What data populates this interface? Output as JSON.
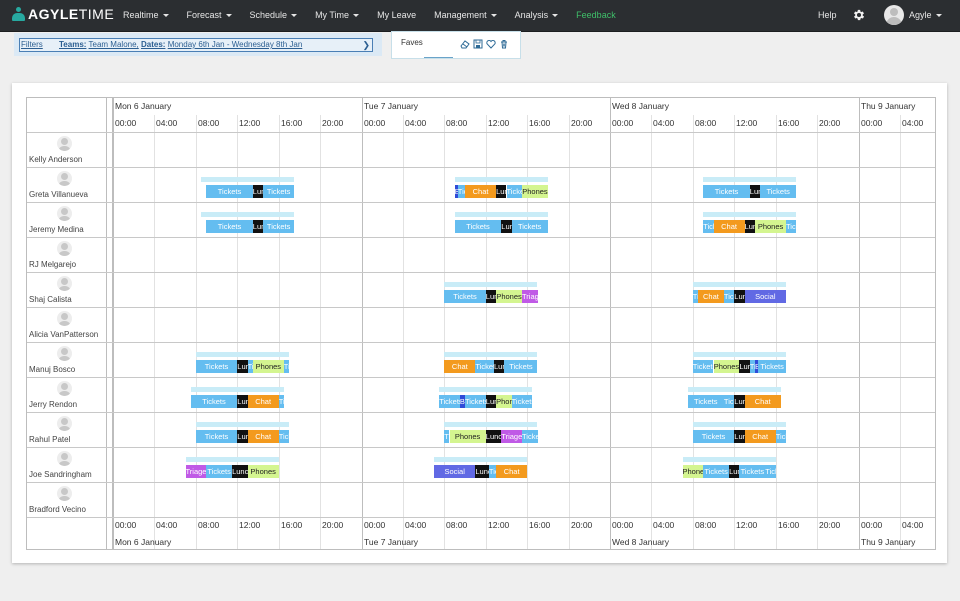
{
  "app": {
    "brand_bold": "AGYLE",
    "brand_light": "TIME"
  },
  "nav": {
    "items": [
      {
        "label": "Realtime",
        "caret": true,
        "color": "#e6e6e6"
      },
      {
        "label": "Forecast",
        "caret": true,
        "color": "#e6e6e6"
      },
      {
        "label": "Schedule",
        "caret": true,
        "color": "#e6e6e6"
      },
      {
        "label": "My Time",
        "caret": true,
        "color": "#e6e6e6"
      },
      {
        "label": "My Leave",
        "caret": false,
        "color": "#e6e6e6"
      },
      {
        "label": "Management",
        "caret": true,
        "color": "#e6e6e6"
      },
      {
        "label": "Analysis",
        "caret": true,
        "color": "#e6e6e6"
      },
      {
        "label": "Feedback",
        "caret": false,
        "color": "#3fbf6a"
      }
    ],
    "help": "Help",
    "settings_icon": "gear-icon",
    "user_name": "Agyle"
  },
  "filters": {
    "link": "Filters",
    "teams_key": "Teams:",
    "teams_value": "Team Malone,",
    "dates_key": "Dates:",
    "dates_value": "Monday 6th Jan - Wednesday 8th Jan"
  },
  "faves": {
    "label": "Faves",
    "icons": [
      "eraser-icon",
      "save-icon",
      "heart-icon",
      "trash-icon"
    ]
  },
  "days": [
    "Mon 6 January",
    "Tue 7 January",
    "Wed 8 January",
    "Thu 9 January"
  ],
  "times": [
    "00:00",
    "04:00",
    "08:00",
    "12:00",
    "16:00",
    "20:00"
  ],
  "activity_colors": {
    "Tickets": "#64bdf0",
    "Lunch": "#111111",
    "Chat": "#f39a1e",
    "Phones": "#d4f590",
    "Triage": "#c05ae6",
    "Social": "#6169e4",
    "Break": "#2f4bd8"
  },
  "activity_dark_text": [
    "Phones"
  ],
  "people": [
    {
      "name": "Kelly Anderson",
      "blocks": []
    },
    {
      "name": "Greta Villanueva",
      "blocks": [
        {
          "day": 0,
          "shift": [
            8.5,
            17.5
          ],
          "acts": [
            [
              9,
              13.5,
              "Tickets"
            ],
            [
              13.5,
              14.5,
              "Lunch"
            ],
            [
              14.5,
              17.5,
              "Tickets"
            ]
          ]
        },
        {
          "day": 1,
          "shift": [
            9,
            18
          ],
          "acts": [
            [
              9,
              9.3,
              "Break"
            ],
            [
              9.3,
              10,
              "Tickets"
            ],
            [
              10,
              13,
              "Chat"
            ],
            [
              13,
              14,
              "Lunch"
            ],
            [
              14,
              15.5,
              "Tickets"
            ],
            [
              15.5,
              18,
              "Phones"
            ]
          ]
        },
        {
          "day": 2,
          "shift": [
            9,
            18
          ],
          "acts": [
            [
              9,
              13.5,
              "Tickets"
            ],
            [
              13.5,
              14.5,
              "Lunch"
            ],
            [
              14.5,
              18,
              "Tickets"
            ]
          ]
        }
      ]
    },
    {
      "name": "Jeremy Medina",
      "blocks": [
        {
          "day": 0,
          "shift": [
            8.5,
            17.5
          ],
          "acts": [
            [
              9,
              13.5,
              "Tickets"
            ],
            [
              13.5,
              14.5,
              "Lunch"
            ],
            [
              14.5,
              17.5,
              "Tickets"
            ]
          ]
        },
        {
          "day": 1,
          "shift": [
            9,
            18
          ],
          "acts": [
            [
              9,
              13.5,
              "Tickets"
            ],
            [
              13.5,
              14.5,
              "Lunch"
            ],
            [
              14.5,
              18,
              "Tickets"
            ]
          ]
        },
        {
          "day": 2,
          "shift": [
            9,
            18
          ],
          "acts": [
            [
              9,
              10,
              "Tickets"
            ],
            [
              10,
              13,
              "Chat"
            ],
            [
              13,
              14,
              "Lunch"
            ],
            [
              14,
              17,
              "Phones"
            ],
            [
              17,
              18,
              "Tickets"
            ]
          ]
        }
      ]
    },
    {
      "name": "RJ Melgarejo",
      "blocks": []
    },
    {
      "name": "Shaj Calista",
      "blocks": [
        {
          "day": 1,
          "shift": [
            8,
            17
          ],
          "acts": [
            [
              8,
              12,
              "Tickets"
            ],
            [
              12,
              13,
              "Lunch"
            ],
            [
              13,
              15.5,
              "Phones"
            ],
            [
              15.5,
              17,
              "Triage"
            ]
          ]
        },
        {
          "day": 2,
          "shift": [
            8,
            17
          ],
          "acts": [
            [
              8,
              8.5,
              "Tickets"
            ],
            [
              8.5,
              11,
              "Chat"
            ],
            [
              11,
              12,
              "Tickets"
            ],
            [
              12,
              13,
              "Lunch"
            ],
            [
              13,
              17,
              "Social"
            ]
          ]
        }
      ]
    },
    {
      "name": "Alicia VanPatterson",
      "blocks": []
    },
    {
      "name": "Manuj Bosco",
      "blocks": [
        {
          "day": 0,
          "shift": [
            8,
            17
          ],
          "acts": [
            [
              8,
              12,
              "Tickets"
            ],
            [
              12,
              13,
              "Lunch"
            ],
            [
              13,
              13.5,
              "Tickets"
            ],
            [
              13.5,
              16.5,
              "Phones"
            ],
            [
              16.5,
              17,
              "Tickets"
            ]
          ]
        },
        {
          "day": 1,
          "shift": [
            8,
            17
          ],
          "acts": [
            [
              8,
              11,
              "Chat"
            ],
            [
              11,
              12.8,
              "Tickets"
            ],
            [
              12.8,
              13.8,
              "Lunch"
            ],
            [
              13.8,
              17,
              "Tickets"
            ]
          ]
        },
        {
          "day": 2,
          "shift": [
            8,
            17
          ],
          "acts": [
            [
              8,
              10,
              "Tickets"
            ],
            [
              10,
              12.5,
              "Phones"
            ],
            [
              12.5,
              13.5,
              "Lunch"
            ],
            [
              13.5,
              14,
              "Tickets"
            ],
            [
              14,
              14.3,
              "Break"
            ],
            [
              14.3,
              17,
              "Tickets"
            ]
          ]
        }
      ]
    },
    {
      "name": "Jerry Rendon",
      "blocks": [
        {
          "day": 0,
          "shift": [
            7.5,
            16.5
          ],
          "acts": [
            [
              7.5,
              12,
              "Tickets"
            ],
            [
              12,
              13,
              "Lunch"
            ],
            [
              13,
              16,
              "Chat"
            ],
            [
              16,
              16.5,
              "Tickets"
            ]
          ]
        },
        {
          "day": 1,
          "shift": [
            7.5,
            16.5
          ],
          "acts": [
            [
              7.5,
              9.5,
              "Tickets"
            ],
            [
              9.5,
              10,
              "Break"
            ],
            [
              10,
              12,
              "Tickets"
            ],
            [
              12,
              13,
              "Lunch"
            ],
            [
              13,
              14.5,
              "Phones"
            ],
            [
              14.5,
              16.5,
              "Tickets"
            ]
          ]
        },
        {
          "day": 2,
          "shift": [
            7.5,
            16.5
          ],
          "acts": [
            [
              7.5,
              11,
              "Tickets"
            ],
            [
              11,
              12,
              "Tickets"
            ],
            [
              12,
              13,
              "Lunch"
            ],
            [
              13,
              16.5,
              "Chat"
            ]
          ]
        }
      ]
    },
    {
      "name": "Rahul Patel",
      "blocks": [
        {
          "day": 0,
          "shift": [
            8,
            17
          ],
          "acts": [
            [
              8,
              12,
              "Tickets"
            ],
            [
              12,
              13,
              "Lunch"
            ],
            [
              13,
              16,
              "Chat"
            ],
            [
              16,
              17,
              "Tickets"
            ]
          ]
        },
        {
          "day": 1,
          "shift": [
            8,
            17
          ],
          "acts": [
            [
              8,
              8.5,
              "Tickets"
            ],
            [
              8.5,
              12,
              "Phones"
            ],
            [
              12,
              13.5,
              "Lunch"
            ],
            [
              13.5,
              15.5,
              "Triage"
            ],
            [
              15.5,
              17,
              "Tickets"
            ]
          ]
        },
        {
          "day": 2,
          "shift": [
            8,
            17
          ],
          "acts": [
            [
              8,
              12,
              "Tickets"
            ],
            [
              12,
              13,
              "Lunch"
            ],
            [
              13,
              16,
              "Chat"
            ],
            [
              16,
              17,
              "Tickets"
            ]
          ]
        }
      ]
    },
    {
      "name": "Joe Sandringham",
      "blocks": [
        {
          "day": 0,
          "shift": [
            7,
            16
          ],
          "acts": [
            [
              7,
              9,
              "Triage"
            ],
            [
              9,
              11.5,
              "Tickets"
            ],
            [
              11.5,
              13,
              "Lunch"
            ],
            [
              13,
              16,
              "Phones"
            ]
          ]
        },
        {
          "day": 1,
          "shift": [
            7,
            16
          ],
          "acts": [
            [
              7,
              11,
              "Social"
            ],
            [
              11,
              12.3,
              "Lunch"
            ],
            [
              12.3,
              13,
              "Tickets"
            ],
            [
              13,
              16,
              "Chat"
            ]
          ]
        },
        {
          "day": 2,
          "shift": [
            7,
            16
          ],
          "acts": [
            [
              7,
              9,
              "Phones"
            ],
            [
              9,
              11.5,
              "Tickets"
            ],
            [
              11.5,
              12.5,
              "Lunch"
            ],
            [
              12.5,
              15,
              "Tickets"
            ],
            [
              15,
              16,
              "Tickets"
            ]
          ]
        }
      ]
    },
    {
      "name": "Bradford Vecino",
      "blocks": []
    }
  ]
}
